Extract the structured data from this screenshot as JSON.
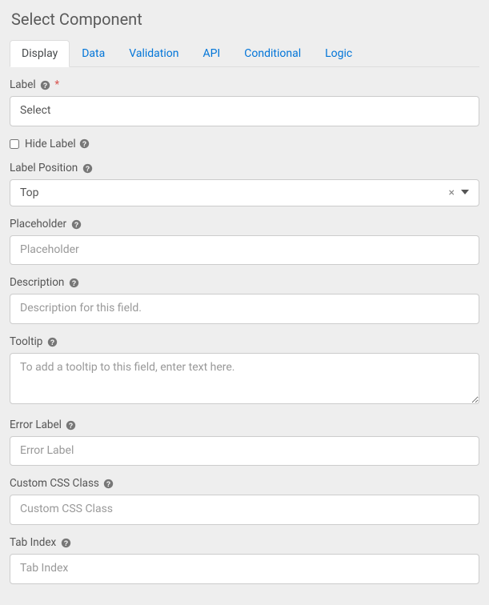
{
  "title": "Select Component",
  "tabs": [
    {
      "label": "Display",
      "active": true
    },
    {
      "label": "Data",
      "active": false
    },
    {
      "label": "Validation",
      "active": false
    },
    {
      "label": "API",
      "active": false
    },
    {
      "label": "Conditional",
      "active": false
    },
    {
      "label": "Logic",
      "active": false
    }
  ],
  "fields": {
    "label": {
      "title": "Label",
      "value": "Select",
      "required": true
    },
    "hideLabel": {
      "title": "Hide Label",
      "checked": false
    },
    "labelPosition": {
      "title": "Label Position",
      "value": "Top"
    },
    "placeholder": {
      "title": "Placeholder",
      "placeholder": "Placeholder",
      "value": ""
    },
    "description": {
      "title": "Description",
      "placeholder": "Description for this field.",
      "value": ""
    },
    "tooltip": {
      "title": "Tooltip",
      "placeholder": "To add a tooltip to this field, enter text here.",
      "value": ""
    },
    "errorLabel": {
      "title": "Error Label",
      "placeholder": "Error Label",
      "value": ""
    },
    "customCssClass": {
      "title": "Custom CSS Class",
      "placeholder": "Custom CSS Class",
      "value": ""
    },
    "tabIndex": {
      "title": "Tab Index",
      "placeholder": "Tab Index",
      "value": ""
    }
  }
}
